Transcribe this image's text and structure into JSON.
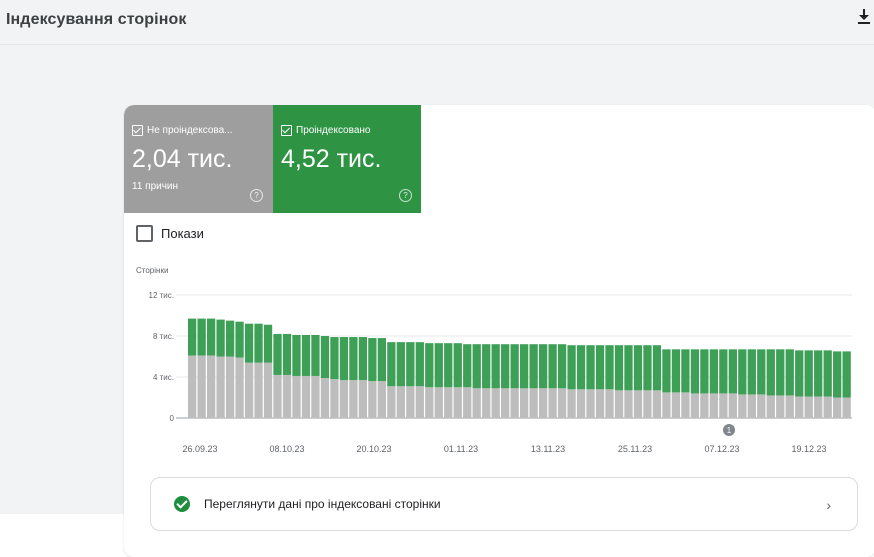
{
  "header": {
    "title": "Індексування сторінок",
    "download_icon": "download-icon"
  },
  "tiles": [
    {
      "label": "Не проіндексова...",
      "value": "2,04 тис.",
      "sub": "11 причин",
      "color": "#9e9e9e",
      "help": "?"
    },
    {
      "label": "Проіндексовано",
      "value": "4,52 тис.",
      "sub": "",
      "color": "#2e9443",
      "help": "?"
    }
  ],
  "impressions_checkbox": {
    "label": "Покази",
    "checked": false
  },
  "action": {
    "label": "Переглянути дані про індексовані сторінки",
    "icon": "check-circle-icon",
    "chevron": "›"
  },
  "chart_data": {
    "type": "bar",
    "stacked": true,
    "ylabel": "Сторінки",
    "y_ticks": [
      "0",
      "4 тис.",
      "8 тис.",
      "12 тис."
    ],
    "ylim": [
      0,
      12000
    ],
    "x_tick_labels": [
      "26.09.23",
      "08.10.23",
      "20.10.23",
      "01.11.23",
      "13.11.23",
      "25.11.23",
      "07.12.23",
      "19.12.23"
    ],
    "annotation": {
      "label": "1",
      "date": "07.12.23"
    },
    "colors": {
      "not_indexed": "#bdbdbd",
      "indexed": "#3ea057"
    },
    "series": [
      {
        "key": "not_indexed",
        "values": [
          6100,
          6100,
          6100,
          6000,
          6000,
          5900,
          5400,
          5400,
          5400,
          4200,
          4200,
          4100,
          4100,
          4100,
          3900,
          3800,
          3700,
          3700,
          3700,
          3600,
          3600,
          3100,
          3100,
          3100,
          3100,
          3000,
          3000,
          3000,
          3000,
          3000,
          2900,
          2900,
          2900,
          2900,
          2900,
          2900,
          2900,
          2900,
          2900,
          2900,
          2800,
          2800,
          2800,
          2800,
          2800,
          2700,
          2700,
          2700,
          2700,
          2700,
          2500,
          2500,
          2500,
          2400,
          2400,
          2400,
          2400,
          2400,
          2300,
          2300,
          2300,
          2200,
          2200,
          2200,
          2100,
          2100,
          2100,
          2100,
          2000,
          2000
        ]
      },
      {
        "key": "indexed",
        "values": [
          3600,
          3600,
          3600,
          3600,
          3500,
          3500,
          3800,
          3800,
          3700,
          4000,
          4000,
          4000,
          4000,
          4000,
          4100,
          4100,
          4200,
          4200,
          4200,
          4200,
          4200,
          4300,
          4300,
          4300,
          4300,
          4300,
          4300,
          4300,
          4300,
          4200,
          4300,
          4300,
          4300,
          4300,
          4300,
          4300,
          4300,
          4300,
          4300,
          4300,
          4300,
          4300,
          4300,
          4300,
          4300,
          4400,
          4400,
          4400,
          4400,
          4400,
          4200,
          4200,
          4200,
          4300,
          4300,
          4300,
          4300,
          4300,
          4400,
          4400,
          4400,
          4500,
          4500,
          4500,
          4500,
          4500,
          4500,
          4500,
          4500,
          4500
        ]
      }
    ]
  }
}
